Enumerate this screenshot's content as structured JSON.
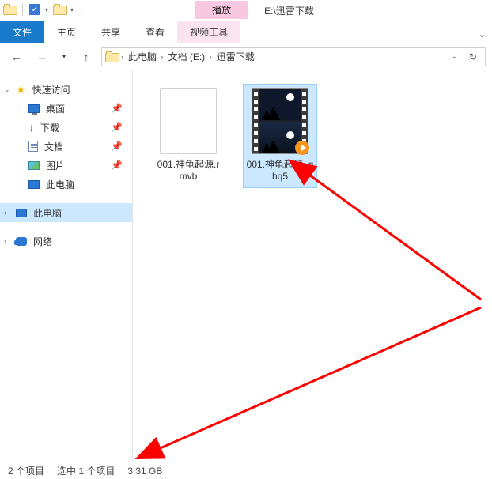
{
  "titlebar": {
    "contextual_label": "播放",
    "window_title": "E:\\迅雷下载"
  },
  "ribbon": {
    "file": "文件",
    "home": "主页",
    "share": "共享",
    "view": "查看",
    "video_tools": "视频工具"
  },
  "breadcrumb": {
    "items": [
      "此电脑",
      "文档 (E:)",
      "迅雷下载"
    ]
  },
  "sidebar": {
    "quick_access": "快速访问",
    "desktop": "桌面",
    "downloads": "下载",
    "documents": "文档",
    "pictures": "图片",
    "this_pc_q": "此电脑",
    "this_pc": "此电脑",
    "network": "网络"
  },
  "files": [
    {
      "name": "001.神龟起源.rmvb",
      "type": "blank",
      "selected": false
    },
    {
      "name": "001.神龟起源_ghq5",
      "type": "video",
      "selected": true
    }
  ],
  "status": {
    "count": "2 个项目",
    "selection": "选中 1 个项目",
    "size": "3.31 GB"
  }
}
